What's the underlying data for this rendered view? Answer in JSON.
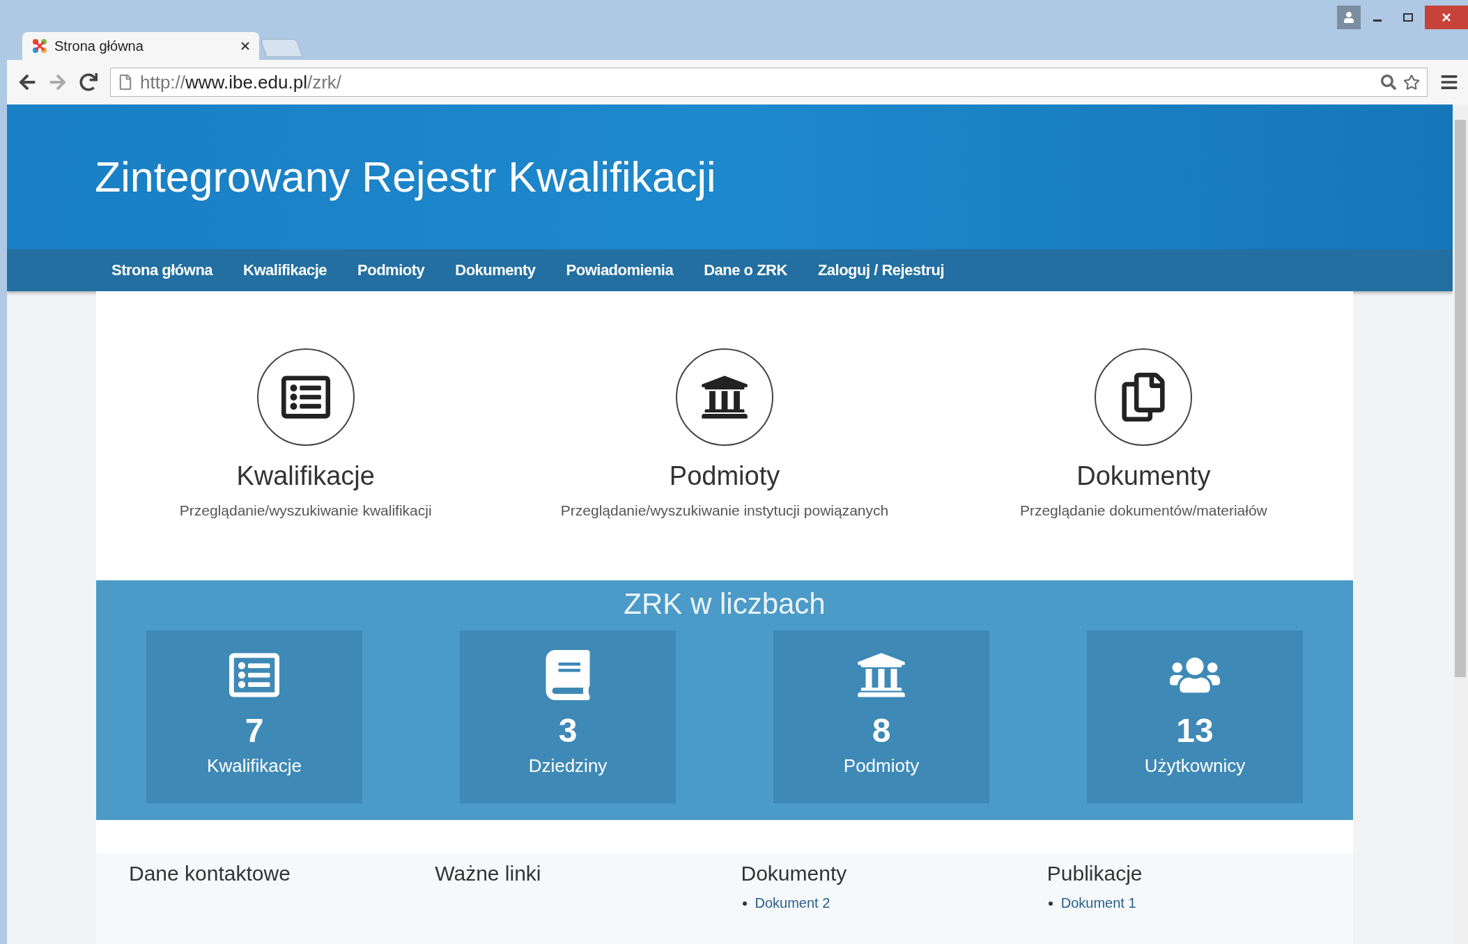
{
  "browser": {
    "tab_title": "Strona główna",
    "url": {
      "scheme": "http://",
      "host": "www.ibe.edu.pl",
      "path": "/zrk/"
    }
  },
  "header": {
    "title": "Zintegrowany Rejestr Kwalifikacji"
  },
  "nav": [
    "Strona główna",
    "Kwalifikacje",
    "Podmioty",
    "Dokumenty",
    "Powiadomienia",
    "Dane o ZRK",
    "Zaloguj / Rejestruj"
  ],
  "features": [
    {
      "kind": "list",
      "title": "Kwalifikacje",
      "description": "Przeglądanie/wyszukiwanie kwalifikacji"
    },
    {
      "kind": "building",
      "title": "Podmioty",
      "description": "Przeglądanie/wyszukiwanie instytucji powiązanych"
    },
    {
      "kind": "documents",
      "title": "Dokumenty",
      "description": "Przeglądanie dokumentów/materiałów"
    }
  ],
  "stats": {
    "title": "ZRK w liczbach",
    "items": [
      {
        "kind": "list",
        "value": "7",
        "label": "Kwalifikacje"
      },
      {
        "kind": "book",
        "value": "3",
        "label": "Dziedziny"
      },
      {
        "kind": "building",
        "value": "8",
        "label": "Podmioty"
      },
      {
        "kind": "users",
        "value": "13",
        "label": "Użytkownicy"
      }
    ]
  },
  "footer": [
    {
      "heading": "Dane kontaktowe"
    },
    {
      "heading": "Ważne linki"
    },
    {
      "heading": "Dokumenty",
      "items": [
        "Dokument 2"
      ]
    },
    {
      "heading": "Publikacje",
      "items": [
        "Dokument 1"
      ]
    }
  ]
}
